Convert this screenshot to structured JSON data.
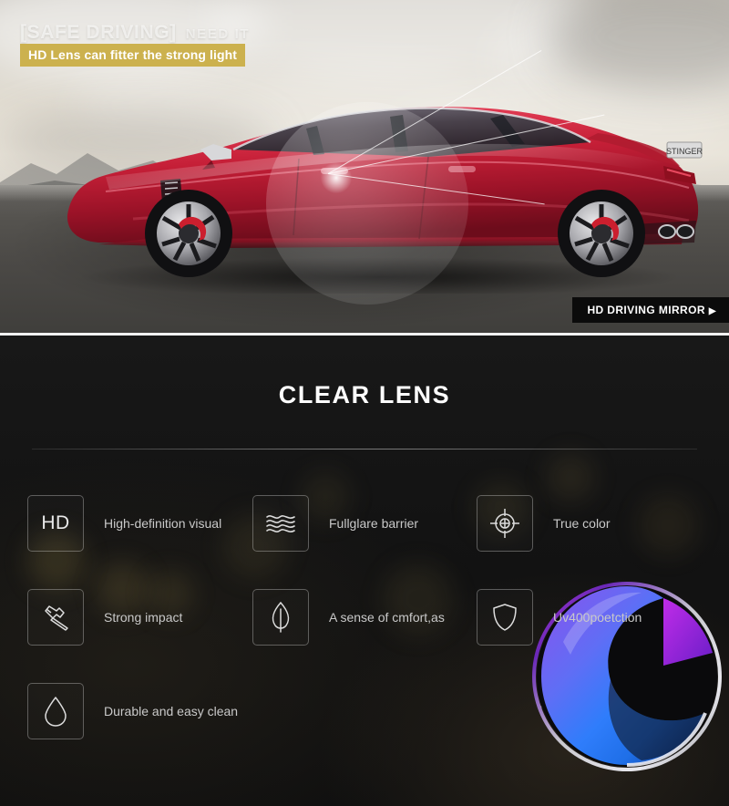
{
  "hero": {
    "kicker_main": "[SAFE DRIVING]",
    "kicker_sub": "NEED IT",
    "badge_text": "HD Lens can fitter the strong light",
    "corner_tag": "HD DRIVING MIRROR",
    "corner_tag_caret": "▶",
    "subject": "red-sports-car-photo",
    "accent_badge_color": "#ccb14e"
  },
  "panel": {
    "title": "CLEAR LENS",
    "background_color": "#151515",
    "product_photo_name": "blue-purple-lens-photo",
    "features": [
      {
        "icon": "hd-text-icon",
        "icon_text": "HD",
        "label": "High-definition visual"
      },
      {
        "icon": "waves-icon",
        "icon_text": "",
        "label": "Fullglare barrier"
      },
      {
        "icon": "crosshair-icon",
        "icon_text": "",
        "label": "True color"
      },
      {
        "icon": "hammer-icon",
        "icon_text": "",
        "label": "Strong impact"
      },
      {
        "icon": "leaf-icon",
        "icon_text": "",
        "label": "A sense  of cmfort,as"
      },
      {
        "icon": "shield-icon",
        "icon_text": "",
        "label": "Uv400poetction"
      },
      {
        "icon": "water-drop-icon",
        "icon_text": "",
        "label": "Durable and easy clean"
      }
    ]
  }
}
